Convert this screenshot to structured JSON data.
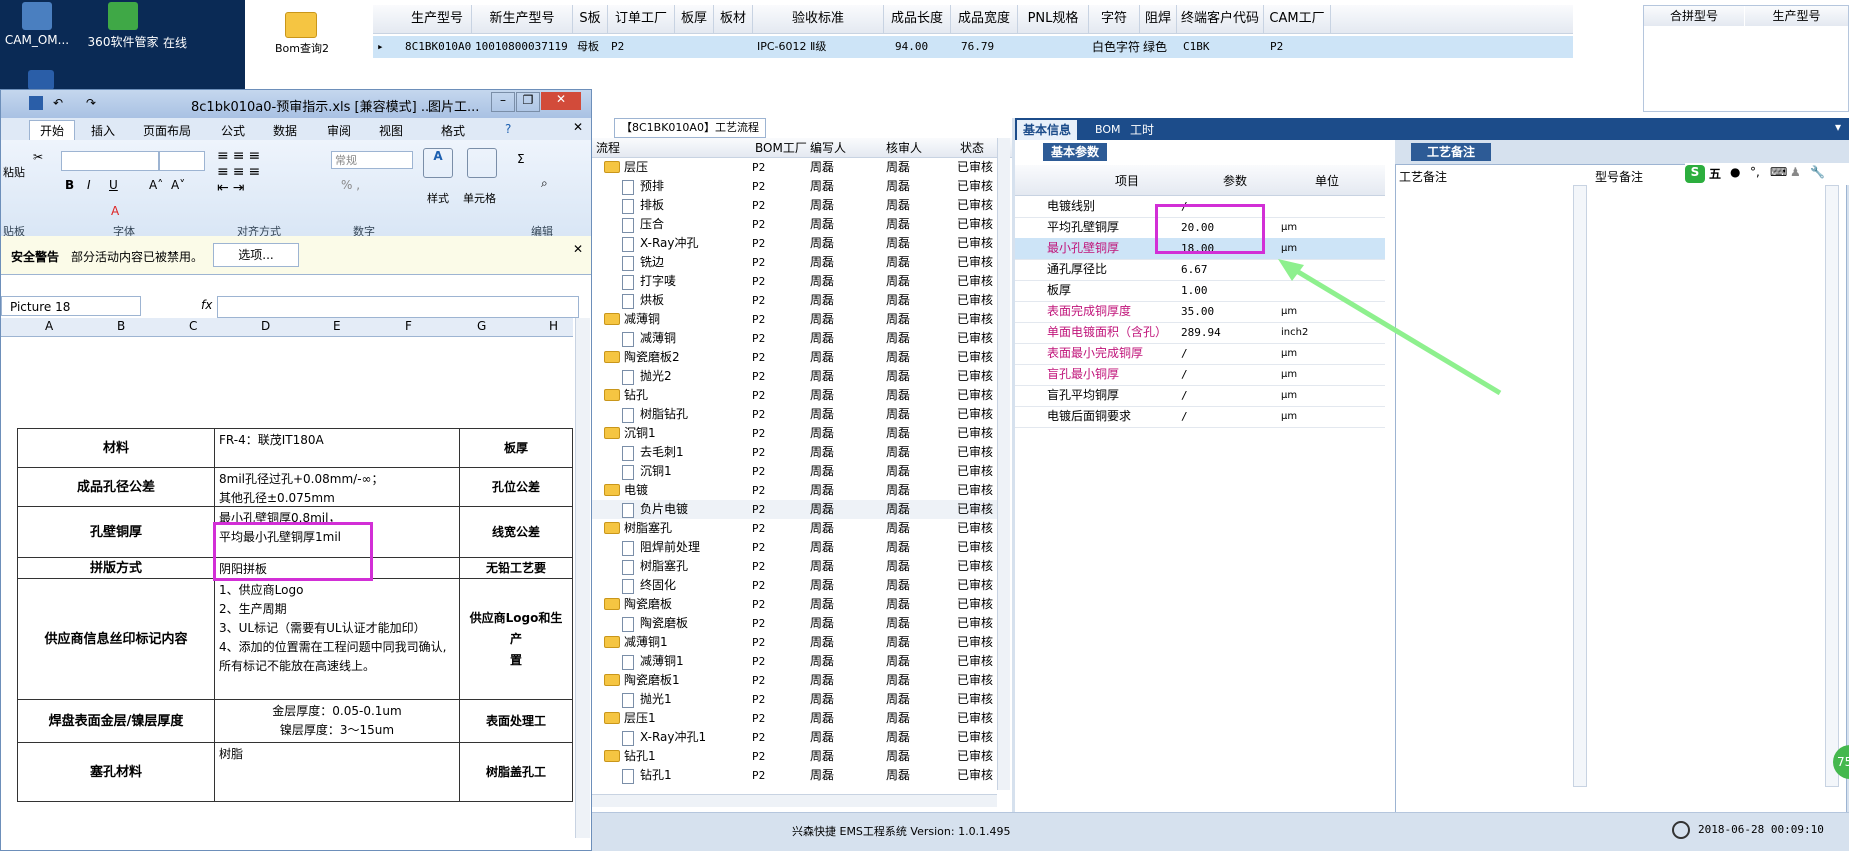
{
  "desktop": {
    "icons": [
      {
        "label": "CAM_OM..."
      },
      {
        "label": "360软件管家"
      },
      {
        "label": "在线"
      }
    ]
  },
  "left_strip": {
    "folder_label": "Bom查询2"
  },
  "order_table": {
    "headers": [
      "生产型号",
      "新生产型号",
      "S板",
      "订单工厂",
      "板厚",
      "板材",
      "验收标准",
      "成品长度",
      "成品宽度",
      "PNL规格",
      "字符",
      "阻焊",
      "终端客户代码",
      "CAM工厂"
    ],
    "row": [
      "8C1BK010A0",
      "10010800037119",
      "母板",
      "P2",
      "",
      "",
      "IPC-6012 Ⅱ级",
      "94.00",
      "76.79",
      "",
      "白色字符",
      "绿色",
      "C1BK",
      "P2"
    ],
    "right_headers": [
      "合拼型号",
      "生产型号"
    ]
  },
  "excel": {
    "title": "8c1bk010a0-预审指示.xls  [兼容模式] ...",
    "title_extra": "图片工...",
    "tabs": [
      "开始",
      "插入",
      "页面布局",
      "公式",
      "数据",
      "审阅",
      "视图",
      "格式"
    ],
    "groups": [
      "贴板",
      "字体",
      "对齐方式",
      "数字",
      "样式",
      "单元格",
      "编辑"
    ],
    "number_format": "常规",
    "style_label": "样式",
    "cell_label": "单元格",
    "paste_label": "粘贴",
    "security": {
      "title": "安全警告",
      "text": "部分活动内容已被禁用。",
      "button": "选项..."
    },
    "namebox": "Picture 18",
    "fx": "fx",
    "columns": [
      "A",
      "B",
      "C",
      "D",
      "E",
      "F",
      "G",
      "H"
    ],
    "table": [
      {
        "label": "材料",
        "value": "FR-4：联茂IT180A",
        "right": "板厚"
      },
      {
        "label": "成品孔径公差",
        "value": "8mil孔径过孔+0.08mm/-∞；\n其他孔径±0.075mm",
        "right": "孔位公差"
      },
      {
        "label": "孔壁铜厚",
        "value": "最小孔壁铜厚0.8mil，\n平均最小孔壁铜厚1mil",
        "right": "线宽公差"
      },
      {
        "label": "拼版方式",
        "value": "阴阳拼板",
        "right": "无铅工艺要"
      },
      {
        "label": "供应商信息丝印标记内容",
        "value": "1、供应商Logo\n2、生产周期\n3、UL标记（需要有UL认证才能加印）\n4、添加的位置需在工程问题中同我司确认,所有标记不能放在高速线上。",
        "right": "供应商Logo和生产\n置"
      },
      {
        "label": "焊盘表面金层/镍层厚度",
        "value": "金层厚度：0.05-0.1um\n镍层厚度：3～15um",
        "right": "表面处理工"
      },
      {
        "label": "塞孔材料",
        "value": "树脂",
        "right": "树脂盖孔工"
      }
    ]
  },
  "process": {
    "tab": "【8C1BK010A0】工艺流程",
    "headers": [
      "流程",
      "BOM工厂",
      "编写人",
      "核审人",
      "状态"
    ],
    "rows": [
      {
        "name": "层压",
        "type": "folder",
        "level": 1,
        "f": "P2",
        "w": "周磊",
        "r": "周磊",
        "s": "已审核"
      },
      {
        "name": "预排",
        "type": "file",
        "level": 2,
        "f": "P2",
        "w": "周磊",
        "r": "周磊",
        "s": "已审核"
      },
      {
        "name": "排板",
        "type": "file",
        "level": 2,
        "f": "P2",
        "w": "周磊",
        "r": "周磊",
        "s": "已审核"
      },
      {
        "name": "压合",
        "type": "file",
        "level": 2,
        "f": "P2",
        "w": "周磊",
        "r": "周磊",
        "s": "已审核"
      },
      {
        "name": "X-Ray冲孔",
        "type": "file",
        "level": 2,
        "f": "P2",
        "w": "周磊",
        "r": "周磊",
        "s": "已审核"
      },
      {
        "name": "铣边",
        "type": "file",
        "level": 2,
        "f": "P2",
        "w": "周磊",
        "r": "周磊",
        "s": "已审核"
      },
      {
        "name": "打字唛",
        "type": "file",
        "level": 2,
        "f": "P2",
        "w": "周磊",
        "r": "周磊",
        "s": "已审核"
      },
      {
        "name": "烘板",
        "type": "file",
        "level": 2,
        "f": "P2",
        "w": "周磊",
        "r": "周磊",
        "s": "已审核"
      },
      {
        "name": "减薄铜",
        "type": "folder",
        "level": 1,
        "f": "P2",
        "w": "周磊",
        "r": "周磊",
        "s": "已审核"
      },
      {
        "name": "减薄铜",
        "type": "file",
        "level": 2,
        "f": "P2",
        "w": "周磊",
        "r": "周磊",
        "s": "已审核"
      },
      {
        "name": "陶瓷磨板2",
        "type": "folder",
        "level": 1,
        "f": "P2",
        "w": "周磊",
        "r": "周磊",
        "s": "已审核"
      },
      {
        "name": "抛光2",
        "type": "file",
        "level": 2,
        "f": "P2",
        "w": "周磊",
        "r": "周磊",
        "s": "已审核"
      },
      {
        "name": "钻孔",
        "type": "folder",
        "level": 1,
        "f": "P2",
        "w": "周磊",
        "r": "周磊",
        "s": "已审核"
      },
      {
        "name": "树脂钻孔",
        "type": "file",
        "level": 2,
        "f": "P2",
        "w": "周磊",
        "r": "周磊",
        "s": "已审核"
      },
      {
        "name": "沉铜1",
        "type": "folder",
        "level": 1,
        "f": "P2",
        "w": "周磊",
        "r": "周磊",
        "s": "已审核"
      },
      {
        "name": "去毛刺1",
        "type": "file",
        "level": 2,
        "f": "P2",
        "w": "周磊",
        "r": "周磊",
        "s": "已审核"
      },
      {
        "name": "沉铜1",
        "type": "file",
        "level": 2,
        "f": "P2",
        "w": "周磊",
        "r": "周磊",
        "s": "已审核"
      },
      {
        "name": "电镀",
        "type": "folder",
        "level": 1,
        "f": "P2",
        "w": "周磊",
        "r": "周磊",
        "s": "已审核"
      },
      {
        "name": "负片电镀",
        "type": "file",
        "level": 2,
        "f": "P2",
        "w": "周磊",
        "r": "周磊",
        "s": "已审核"
      },
      {
        "name": "树脂塞孔",
        "type": "folder",
        "level": 1,
        "f": "P2",
        "w": "周磊",
        "r": "周磊",
        "s": "已审核"
      },
      {
        "name": "阻焊前处理",
        "type": "file",
        "level": 2,
        "f": "P2",
        "w": "周磊",
        "r": "周磊",
        "s": "已审核"
      },
      {
        "name": "树脂塞孔",
        "type": "file",
        "level": 2,
        "f": "P2",
        "w": "周磊",
        "r": "周磊",
        "s": "已审核"
      },
      {
        "name": "终固化",
        "type": "file",
        "level": 2,
        "f": "P2",
        "w": "周磊",
        "r": "周磊",
        "s": "已审核"
      },
      {
        "name": "陶瓷磨板",
        "type": "folder",
        "level": 1,
        "f": "P2",
        "w": "周磊",
        "r": "周磊",
        "s": "已审核"
      },
      {
        "name": "陶瓷磨板",
        "type": "file",
        "level": 2,
        "f": "P2",
        "w": "周磊",
        "r": "周磊",
        "s": "已审核"
      },
      {
        "name": "减薄铜1",
        "type": "folder",
        "level": 1,
        "f": "P2",
        "w": "周磊",
        "r": "周磊",
        "s": "已审核"
      },
      {
        "name": "减薄铜1",
        "type": "file",
        "level": 2,
        "f": "P2",
        "w": "周磊",
        "r": "周磊",
        "s": "已审核"
      },
      {
        "name": "陶瓷磨板1",
        "type": "folder",
        "level": 1,
        "f": "P2",
        "w": "周磊",
        "r": "周磊",
        "s": "已审核"
      },
      {
        "name": "抛光1",
        "type": "file",
        "level": 2,
        "f": "P2",
        "w": "周磊",
        "r": "周磊",
        "s": "已审核"
      },
      {
        "name": "层压1",
        "type": "folder",
        "level": 1,
        "f": "P2",
        "w": "周磊",
        "r": "周磊",
        "s": "已审核"
      },
      {
        "name": "X-Ray冲孔1",
        "type": "file",
        "level": 2,
        "f": "P2",
        "w": "周磊",
        "r": "周磊",
        "s": "已审核"
      },
      {
        "name": "钻孔1",
        "type": "folder",
        "level": 1,
        "f": "P2",
        "w": "周磊",
        "r": "周磊",
        "s": "已审核"
      },
      {
        "name": "钻孔1",
        "type": "file",
        "level": 2,
        "f": "P2",
        "w": "周磊",
        "r": "周磊",
        "s": "已审核"
      }
    ]
  },
  "info": {
    "tabs": [
      "基本信息",
      "BOM",
      "工时"
    ],
    "subtab": "基本参数",
    "headers": [
      "项目",
      "参数",
      "单位"
    ],
    "params": [
      {
        "item": "电镀线别",
        "value": "/",
        "unit": "",
        "pink": false
      },
      {
        "item": "平均孔壁铜厚",
        "value": "20.00",
        "unit": "μm",
        "pink": false
      },
      {
        "item": "最小孔壁铜厚",
        "value": "18.00",
        "unit": "μm",
        "pink": true
      },
      {
        "item": "通孔厚径比",
        "value": "6.67",
        "unit": "",
        "pink": false
      },
      {
        "item": "板厚",
        "value": "1.00",
        "unit": "",
        "pink": false
      },
      {
        "item": "表面完成铜厚度",
        "value": "35.00",
        "unit": "μm",
        "pink": true
      },
      {
        "item": "单面电镀面积（含孔）",
        "value": "289.94",
        "unit": "inch2",
        "pink": true
      },
      {
        "item": "表面最小完成铜厚",
        "value": "/",
        "unit": "μm",
        "pink": true
      },
      {
        "item": "盲孔最小铜厚",
        "value": "/",
        "unit": "μm",
        "pink": true
      },
      {
        "item": "盲孔平均铜厚",
        "value": "/",
        "unit": "μm",
        "pink": false
      },
      {
        "item": "电镀后面铜要求",
        "value": "/",
        "unit": "μm",
        "pink": false
      }
    ],
    "craft_tab": "工艺备注",
    "craft_headers": [
      "工艺备注",
      "型号备注"
    ]
  },
  "ime": {
    "label": "五"
  },
  "badge": "75",
  "status": {
    "app": "兴森快捷 EMS工程系统 Version: 1.0.1.495",
    "time": "2018-06-28 00:09:10"
  },
  "colors": {
    "highlight": "#d22fd6",
    "arrow": "#8ef08e",
    "selected_row": "#cde4f7",
    "pink_text": "#c0147a"
  }
}
